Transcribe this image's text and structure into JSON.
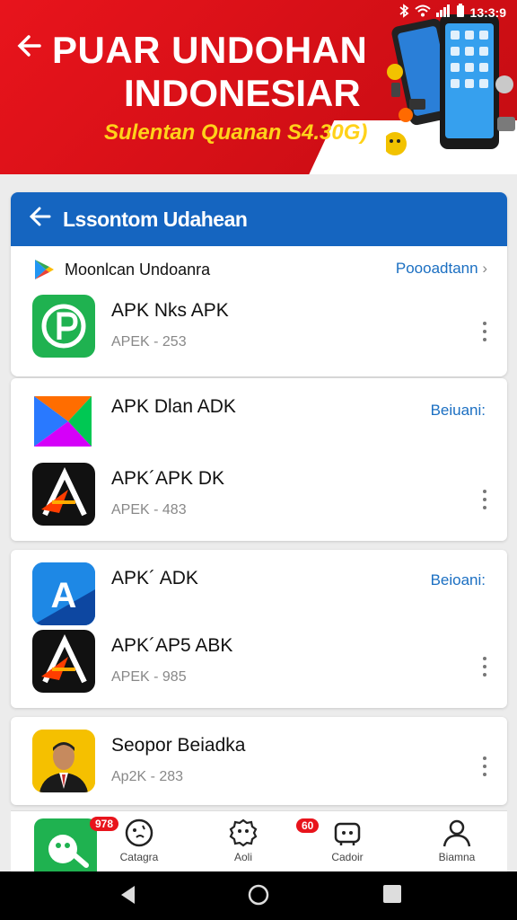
{
  "status_bar": {
    "time": "13:3:9",
    "icons": [
      "bluetooth-icon",
      "wifi-icon",
      "signal-icon",
      "battery-icon"
    ]
  },
  "banner": {
    "title_line1": "PUAR UNDOHAN",
    "title_line2": "INDONESIAR",
    "subtitle": "Sulentan Quanan S4.30G)"
  },
  "section": {
    "header_title": "Lssontom Udahean",
    "subheader_label": "Moonlcan Undoanra",
    "subheader_more": "Poooadtann"
  },
  "apps": [
    {
      "name": "APK Nks APK",
      "meta": "APEK - 253",
      "icon": "green-p-icon"
    },
    {
      "name": "APK  Dlan ADK",
      "meta": "",
      "link": "Beiuani:",
      "icon": "play-triangle-icon"
    },
    {
      "name": "APK´APK DK",
      "meta": "APEK - 483",
      "icon": "black-a-icon"
    },
    {
      "name": "APK´ ADK",
      "meta": "",
      "link": "Beioani:",
      "icon": "blue-a-icon"
    },
    {
      "name": "APK´AP5 ABK",
      "meta": "APEK - 985",
      "icon": "black-a-icon"
    },
    {
      "name": "Seopor Beiadka",
      "meta": "Ap2K - 283",
      "icon": "person-photo-icon"
    }
  ],
  "bottom_nav": [
    {
      "label": "Catagra",
      "badge": "978",
      "icon": "hand-icon"
    },
    {
      "label": "Aoli",
      "badge": "",
      "icon": "gear-face-icon"
    },
    {
      "label": "Cadoir",
      "badge": "60",
      "icon": "bag-icon"
    },
    {
      "label": "Biamna",
      "badge": "",
      "icon": "person-icon"
    }
  ],
  "colors": {
    "banner_red": "#e8141c",
    "header_blue": "#1565c0",
    "link_blue": "#1b6fc2",
    "subtitle_yellow": "#ffd21a"
  }
}
